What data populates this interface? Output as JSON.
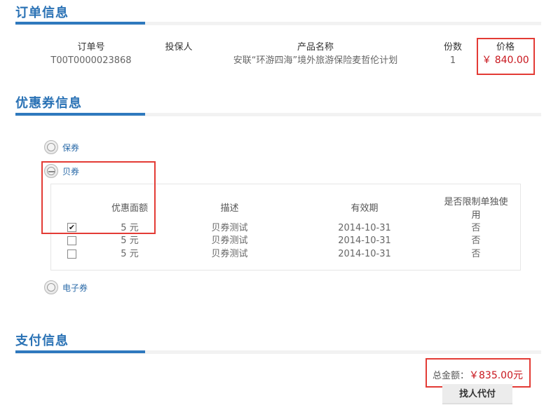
{
  "order": {
    "title": "订单信息",
    "headers": {
      "order_no": "订单号",
      "insured": "投保人",
      "product": "产品名称",
      "quantity": "份数",
      "price": "价格"
    },
    "values": {
      "order_no": "T00T0000023868",
      "insured": "",
      "product": "安联“环游四海”境外旅游保险麦哲伦计划",
      "quantity": "1",
      "price": "￥ 840.00"
    }
  },
  "coupon": {
    "title": "优惠券信息",
    "types": [
      {
        "label": "保券",
        "icon": "coupon-expand-icon"
      },
      {
        "label": "贝券",
        "icon": "coupon-collapse-icon"
      },
      {
        "label": "电子券",
        "icon": "coupon-expand-icon"
      }
    ],
    "table": {
      "headers": {
        "amount": "优惠面额",
        "desc": "描述",
        "expiry": "有效期",
        "exclusive": "是否限制单独使用"
      },
      "rows": [
        {
          "checked": true,
          "amount": "5 元",
          "desc": "贝券测试",
          "expiry": "2014-10-31",
          "exclusive": "否"
        },
        {
          "checked": false,
          "amount": "5 元",
          "desc": "贝券测试",
          "expiry": "2014-10-31",
          "exclusive": "否"
        },
        {
          "checked": false,
          "amount": "5 元",
          "desc": "贝券测试",
          "expiry": "2014-10-31",
          "exclusive": "否"
        }
      ]
    }
  },
  "payment": {
    "title": "支付信息",
    "total_label": "总金额：",
    "total_value": "￥835.00元",
    "pay_button": "找人代付"
  },
  "colors": {
    "accent": "#2f79be",
    "title": "#2a72b5",
    "price": "#c8161d",
    "highlight_box": "#e33b35"
  }
}
